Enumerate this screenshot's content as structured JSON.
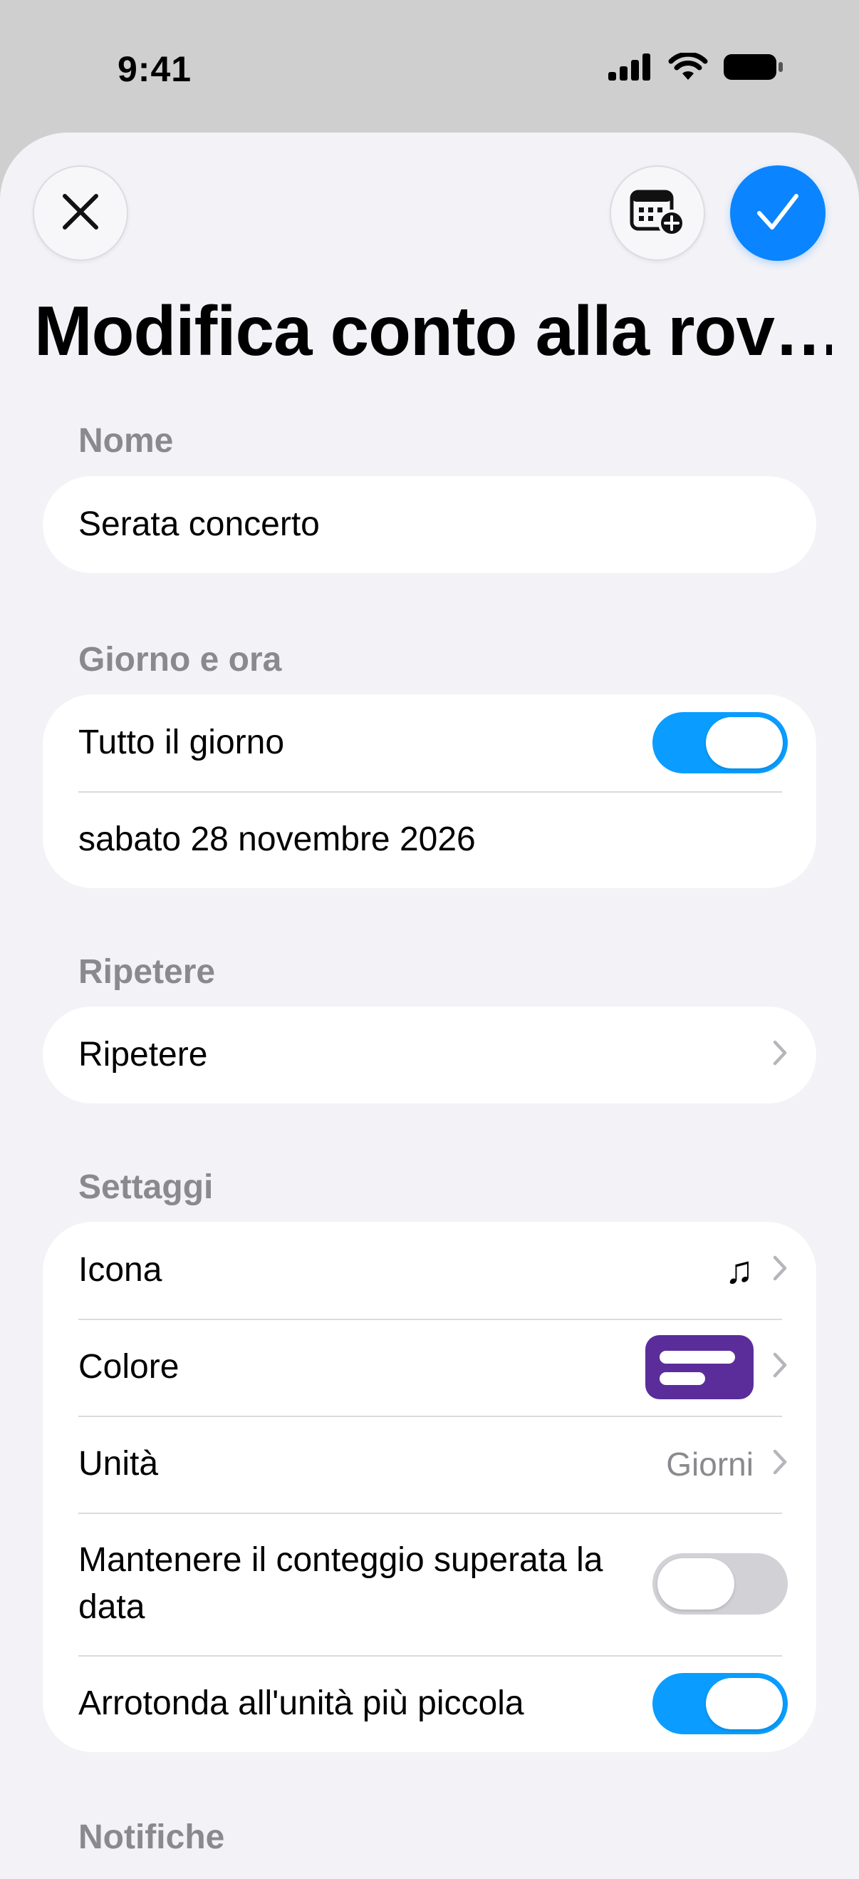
{
  "status_bar": {
    "time": "9:41",
    "icons": [
      "cellular-signal-icon",
      "wifi-icon",
      "battery-icon"
    ]
  },
  "toolbar": {
    "close_icon": "close-icon",
    "calendar_icon": "calendar-add-icon",
    "confirm_icon": "checkmark-icon"
  },
  "title": "Modifica conto alla rov…",
  "sections": {
    "name": {
      "header": "Nome",
      "value": "Serata concerto"
    },
    "date_time": {
      "header": "Giorno e ora",
      "all_day_label": "Tutto il giorno",
      "all_day_on": true,
      "date_value": "sabato 28 novembre 2026"
    },
    "repeat": {
      "header": "Ripetere",
      "label": "Ripetere"
    },
    "settings": {
      "header": "Settaggi",
      "icon_label": "Icona",
      "icon_value": "♫",
      "color_label": "Colore",
      "color_value": "#5b2d9b",
      "unit_label": "Unità",
      "unit_value": "Giorni",
      "keep_count_label": "Mantenere il conteggio superata la data",
      "keep_count_on": false,
      "round_label": "Arrotonda all'unità più piccola",
      "round_on": true
    },
    "notifications": {
      "header": "Notifiche"
    }
  },
  "colors": {
    "accent": "#0a84ff",
    "toggle_on": "#0a9dff",
    "sheet_bg": "#f2f2f7"
  }
}
